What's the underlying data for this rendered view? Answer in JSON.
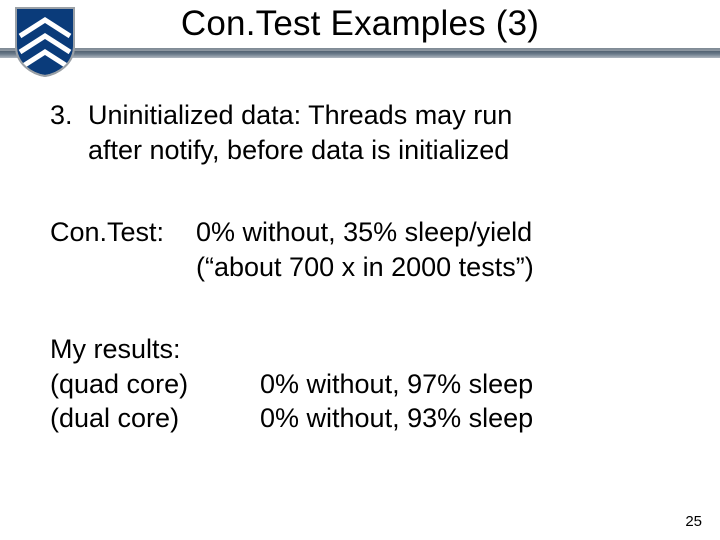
{
  "header": {
    "title": "Con.Test Examples (3)"
  },
  "item3": {
    "number": "3.",
    "text_line1": "Uninitialized data: Threads may run",
    "text_line2": "after notify, before data is initialized"
  },
  "contest": {
    "label": "Con.Test:",
    "line1": "0% without, 35% sleep/yield",
    "line2": "(“about 700 x in 2000 tests”)"
  },
  "myresults": {
    "heading": "My results:",
    "quad_label": "(quad core)",
    "quad_value": "0% without, 97% sleep",
    "dual_label": "(dual core)",
    "dual_value": "0% without, 93% sleep"
  },
  "page_number": "25",
  "colors": {
    "shield_blue": "#0a3b7a",
    "shield_grey": "#9aa0a6"
  }
}
